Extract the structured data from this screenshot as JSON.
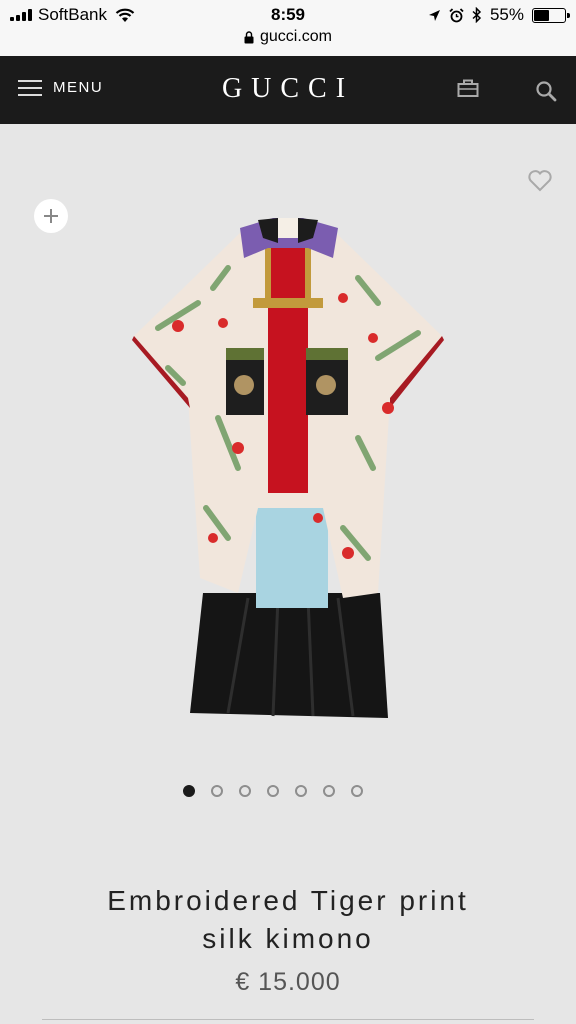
{
  "status_bar": {
    "carrier": "SoftBank",
    "time": "8:59",
    "url": "gucci.com",
    "battery_percent": "55%",
    "battery_level": 0.55
  },
  "header": {
    "menu_label": "MENU",
    "logo": "GUCCI"
  },
  "product": {
    "title_line1": "Embroidered Tiger print",
    "title_line2": "silk kimono",
    "price": "€ 15.000",
    "image_count": 7,
    "active_image": 1
  },
  "icons": [
    "signal-icon",
    "wifi-icon",
    "lock-icon",
    "location-icon",
    "alarm-icon",
    "bluetooth-icon",
    "battery-icon",
    "hamburger-icon",
    "shopping-bag-icon",
    "search-icon",
    "heart-icon",
    "plus-icon"
  ]
}
